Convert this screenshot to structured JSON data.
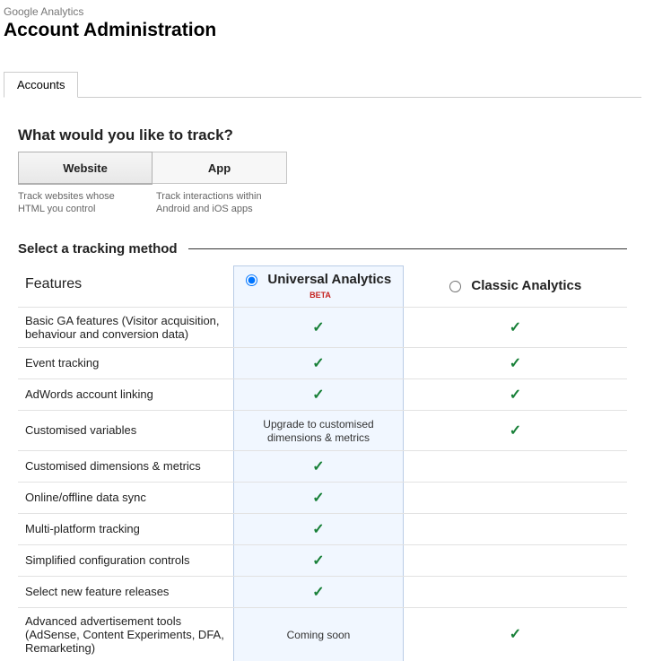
{
  "header": {
    "product": "Google Analytics",
    "title": "Account Administration"
  },
  "tabs": {
    "accounts": "Accounts"
  },
  "question": "What would you like to track?",
  "seg": {
    "website": "Website",
    "app": "App",
    "website_desc": "Track websites whose HTML you control",
    "app_desc": "Track interactions within Android and iOS apps"
  },
  "method": {
    "title": "Select a tracking method",
    "features": "Features",
    "universal": "Universal Analytics",
    "beta": "BETA",
    "classic": "Classic Analytics"
  },
  "rows": {
    "basic": "Basic GA features (Visitor acquisition, behaviour and conversion data)",
    "event": "Event tracking",
    "adwords": "AdWords account linking",
    "customvar": "Customised variables",
    "customvar_ua": "Upgrade to customised dimensions & metrics",
    "dims": "Customised dimensions & metrics",
    "sync": "Online/offline data sync",
    "multi": "Multi-platform tracking",
    "simp": "Simplified configuration controls",
    "newf": "Select new feature releases",
    "ads": "Advanced advertisement tools (AdSense, Content Experiments, DFA, Remarketing)",
    "ads_ua": "Coming soon"
  }
}
